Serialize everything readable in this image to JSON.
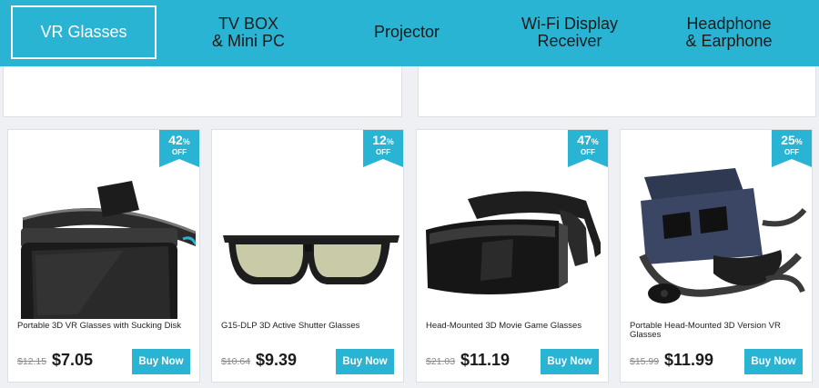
{
  "nav": {
    "tabs": [
      {
        "line1": "VR Glasses",
        "line2": ""
      },
      {
        "line1": "TV BOX",
        "line2": "& Mini PC"
      },
      {
        "line1": "Projector",
        "line2": ""
      },
      {
        "line1": "Wi-Fi Display",
        "line2": "Receiver"
      },
      {
        "line1": "Headphone",
        "line2": "& Earphone"
      }
    ]
  },
  "products": [
    {
      "title": "Portable 3D VR Glasses with Sucking Disk",
      "discount": "42",
      "pct": "%",
      "off": "OFF",
      "old_price": "$12.15",
      "price": "$7.05",
      "buy": "Buy Now",
      "icon": "vr-headset-icon"
    },
    {
      "title": "G15-DLP 3D Active Shutter Glasses",
      "discount": "12",
      "pct": "%",
      "off": "OFF",
      "old_price": "$10.64",
      "price": "$9.39",
      "buy": "Buy Now",
      "icon": "shutter-glasses-icon"
    },
    {
      "title": "Head-Mounted 3D Movie Game Glasses",
      "discount": "47",
      "pct": "%",
      "off": "OFF",
      "old_price": "$21.03",
      "price": "$11.19",
      "buy": "Buy Now",
      "icon": "vr-headset-icon"
    },
    {
      "title": "Portable Head-Mounted 3D Version VR Glasses",
      "discount": "25",
      "pct": "%",
      "off": "OFF",
      "old_price": "$15.99",
      "price": "$11.99",
      "buy": "Buy Now",
      "icon": "vr-headset-remote-icon"
    }
  ],
  "colors": {
    "accent": "#2ab4d3",
    "background": "#eef0f3"
  }
}
